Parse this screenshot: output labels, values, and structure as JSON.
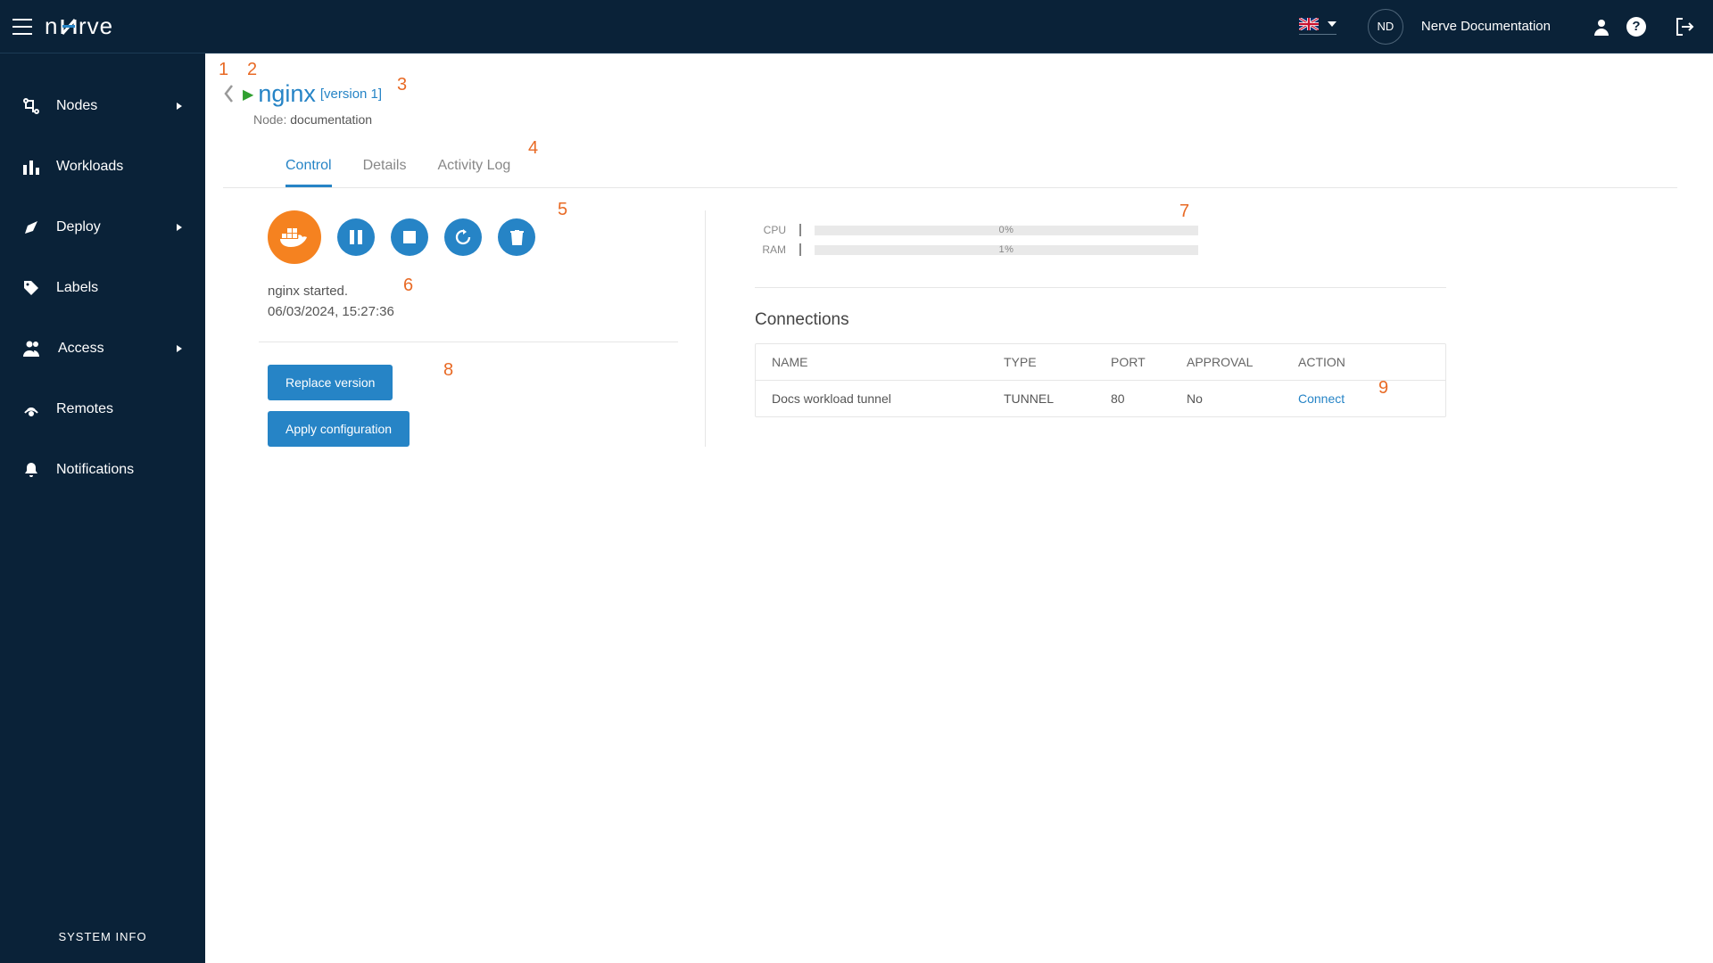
{
  "header": {
    "avatar_initials": "ND",
    "username": "Nerve Documentation"
  },
  "sidebar": {
    "items": [
      {
        "label": "Nodes",
        "expandable": true
      },
      {
        "label": "Workloads",
        "expandable": false
      },
      {
        "label": "Deploy",
        "expandable": true
      },
      {
        "label": "Labels",
        "expandable": false
      },
      {
        "label": "Access",
        "expandable": true
      },
      {
        "label": "Remotes",
        "expandable": false
      },
      {
        "label": "Notifications",
        "expandable": false
      }
    ],
    "system_info": "SYSTEM INFO"
  },
  "page": {
    "title": "nginx",
    "version": "[version 1]",
    "node_prefix": "Node:",
    "node_name": "documentation"
  },
  "tabs": [
    {
      "label": "Control",
      "active": true
    },
    {
      "label": "Details",
      "active": false
    },
    {
      "label": "Activity Log",
      "active": false
    }
  ],
  "status": {
    "message": "nginx started.",
    "timestamp": "06/03/2024, 15:27:36"
  },
  "actions": {
    "replace_version": "Replace version",
    "apply_config": "Apply configuration"
  },
  "meters": {
    "cpu_label": "CPU",
    "cpu_text": "0%",
    "ram_label": "RAM",
    "ram_text": "1%"
  },
  "connections": {
    "title": "Connections",
    "headers": {
      "name": "NAME",
      "type": "TYPE",
      "port": "PORT",
      "approval": "APPROVAL",
      "action": "ACTION"
    },
    "rows": [
      {
        "name": "Docs workload tunnel",
        "type": "TUNNEL",
        "port": "80",
        "approval": "No",
        "action": "Connect"
      }
    ]
  },
  "annotations": {
    "a1": "1",
    "a2": "2",
    "a3": "3",
    "a4": "4",
    "a5": "5",
    "a6": "6",
    "a7": "7",
    "a8": "8",
    "a9": "9"
  }
}
